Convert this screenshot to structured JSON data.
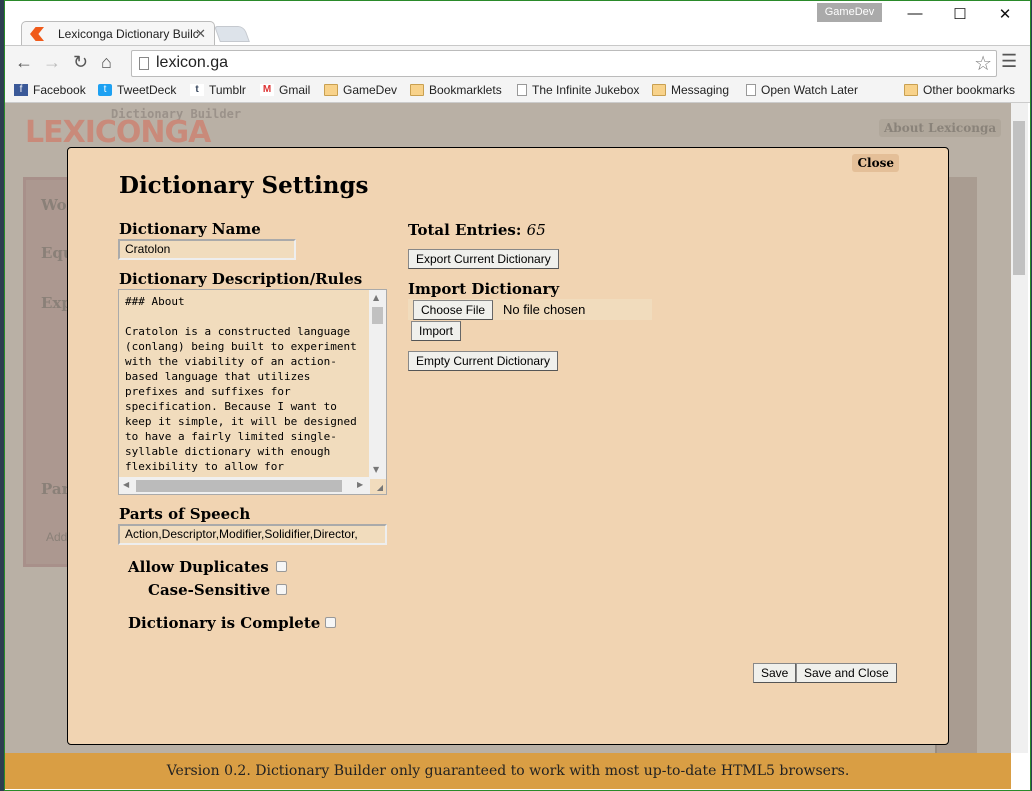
{
  "browser": {
    "tab_title": "Lexiconga Dictionary Builc",
    "profile": "GameDev",
    "url": "lexicon.ga",
    "bookmarks": [
      {
        "label": "Facebook",
        "icon": "facebook-icon"
      },
      {
        "label": "TweetDeck",
        "icon": "tweetdeck-icon"
      },
      {
        "label": "Tumblr",
        "icon": "tumblr-icon"
      },
      {
        "label": "Gmail",
        "icon": "gmail-icon"
      },
      {
        "label": "GameDev",
        "icon": "folder-icon"
      },
      {
        "label": "Bookmarklets",
        "icon": "folder-icon"
      },
      {
        "label": "The Infinite Jukebox",
        "icon": "page-icon"
      },
      {
        "label": "Messaging",
        "icon": "folder-icon"
      },
      {
        "label": "Open Watch Later",
        "icon": "page-icon"
      }
    ],
    "other_bookmarks": "Other bookmarks"
  },
  "site": {
    "logo_sub": "Dictionary Builder",
    "logo": "LEXICONGA",
    "about": "About Lexiconga",
    "bg_labels": [
      "Wo",
      "Equ",
      "Exp",
      "Par",
      "Add"
    ],
    "footer": "Version 0.2. Dictionary Builder only guaranteed to work with most up-to-date HTML5 browsers.",
    "colors": {
      "modal_bg": "#f1d4b2",
      "footer_bg": "#d99e44",
      "accent": "#f05a1a"
    }
  },
  "modal": {
    "title": "Dictionary Settings",
    "close": "Close",
    "name_label": "Dictionary Name",
    "name_value": "Cratolon",
    "desc_label": "Dictionary Description/Rules",
    "desc_value": "### About\n\nCratolon is a constructed language (conlang) being built to experiment with the viability of an action-based language that utilizes prefixes and suffixes for specification. Because I want to keep it simple, it will be designed to have a fairly limited single-syllable dictionary with enough flexibility to allow for",
    "pos_label": "Parts of Speech",
    "pos_value": "Action,Descriptor,Modifier,Solidifier,Director,",
    "allow_duplicates": "Allow Duplicates",
    "case_sensitive": "Case-Sensitive",
    "complete": "Dictionary is Complete",
    "checks": {
      "allow_duplicates": false,
      "case_sensitive": false,
      "complete": false
    },
    "total_label": "Total Entries:",
    "total_value": "65",
    "export": "Export Current Dictionary",
    "import_label": "Import Dictionary",
    "choose_file": "Choose File",
    "no_file": "No file chosen",
    "import": "Import",
    "empty": "Empty Current Dictionary",
    "save": "Save",
    "save_close": "Save and Close"
  }
}
